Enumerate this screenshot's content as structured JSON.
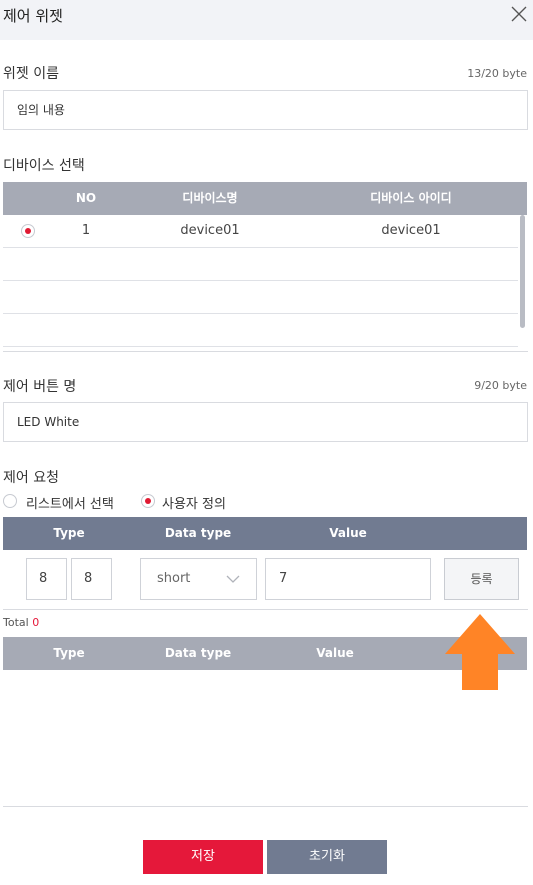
{
  "dialog": {
    "title": "제어 위젯",
    "close_icon": "close-icon"
  },
  "widget_name": {
    "label": "위젯 이름",
    "count": "13/20 byte",
    "value": "임의 내용"
  },
  "device_select": {
    "label": "디바이스 선택",
    "columns": [
      "NO",
      "디바이스명",
      "디바이스 아이디"
    ],
    "rows": [
      {
        "selected": true,
        "no": "1",
        "name": "device01",
        "id": "device01"
      }
    ]
  },
  "control_button_name": {
    "label": "제어 버튼 명",
    "count": "9/20 byte",
    "value": "LED White"
  },
  "control_request": {
    "label": "제어 요청",
    "options": [
      {
        "label": "리스트에서 선택",
        "selected": false
      },
      {
        "label": "사용자 정의",
        "selected": true
      }
    ],
    "columns": [
      "Type",
      "Data type",
      "Value"
    ],
    "input": {
      "type_a": "8",
      "type_b": "8",
      "data_type": "short",
      "value": "7",
      "register_label": "등록"
    }
  },
  "total": {
    "label": "Total",
    "count": "0"
  },
  "result_table": {
    "columns": [
      "Type",
      "Data type",
      "Value"
    ]
  },
  "footer": {
    "save_label": "저장",
    "reset_label": "초기화"
  },
  "colors": {
    "accent_red": "#e5183a",
    "header_dark": "#717b91",
    "header_gray": "#a6aab5",
    "arrow_orange": "#ff8426"
  }
}
